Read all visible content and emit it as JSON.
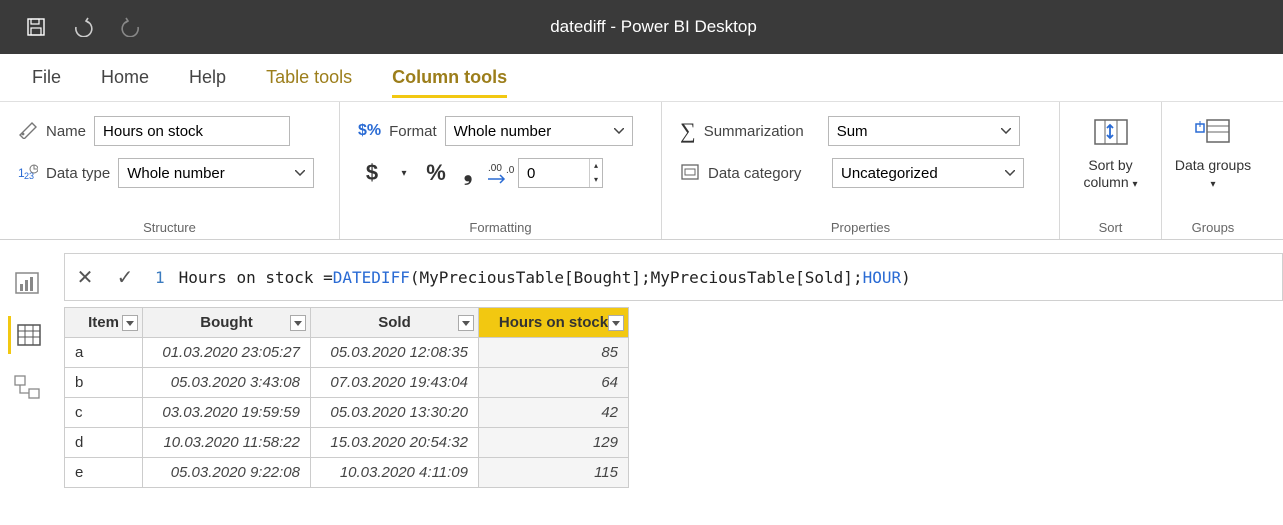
{
  "title": "datediff - Power BI Desktop",
  "tabs": {
    "file": "File",
    "home": "Home",
    "help": "Help",
    "table_tools": "Table tools",
    "column_tools": "Column tools"
  },
  "ribbon": {
    "structure": {
      "label": "Structure",
      "name_label": "Name",
      "name_value": "Hours on stock",
      "datatype_label": "Data type",
      "datatype_value": "Whole number"
    },
    "formatting": {
      "label": "Formatting",
      "format_label": "Format",
      "format_value": "Whole number",
      "currency": "$",
      "percent": "%",
      "comma": ",",
      "decimals_icon": ".00→.0",
      "decimals_value": "0"
    },
    "properties": {
      "label": "Properties",
      "summarization_label": "Summarization",
      "summarization_value": "Sum",
      "datacategory_label": "Data category",
      "datacategory_value": "Uncategorized"
    },
    "sort": {
      "label": "Sort",
      "button": "Sort by column"
    },
    "groups": {
      "label": "Groups",
      "button": "Data groups"
    }
  },
  "formula": {
    "line": "1",
    "lhs": "Hours on stock = ",
    "fn": "DATEDIFF",
    "args_a": "(MyPreciousTable[Bought];MyPreciousTable[Sold];",
    "kw": "HOUR",
    "args_b": ")"
  },
  "table": {
    "headers": {
      "item": "Item",
      "bought": "Bought",
      "sold": "Sold",
      "hours": "Hours on stock"
    },
    "rows": [
      {
        "item": "a",
        "bought": "01.03.2020 23:05:27",
        "sold": "05.03.2020 12:08:35",
        "hours": "85"
      },
      {
        "item": "b",
        "bought": "05.03.2020 3:43:08",
        "sold": "07.03.2020 19:43:04",
        "hours": "64"
      },
      {
        "item": "c",
        "bought": "03.03.2020 19:59:59",
        "sold": "05.03.2020 13:30:20",
        "hours": "42"
      },
      {
        "item": "d",
        "bought": "10.03.2020 11:58:22",
        "sold": "15.03.2020 20:54:32",
        "hours": "129"
      },
      {
        "item": "e",
        "bought": "05.03.2020 9:22:08",
        "sold": "10.03.2020 4:11:09",
        "hours": "115"
      }
    ]
  }
}
